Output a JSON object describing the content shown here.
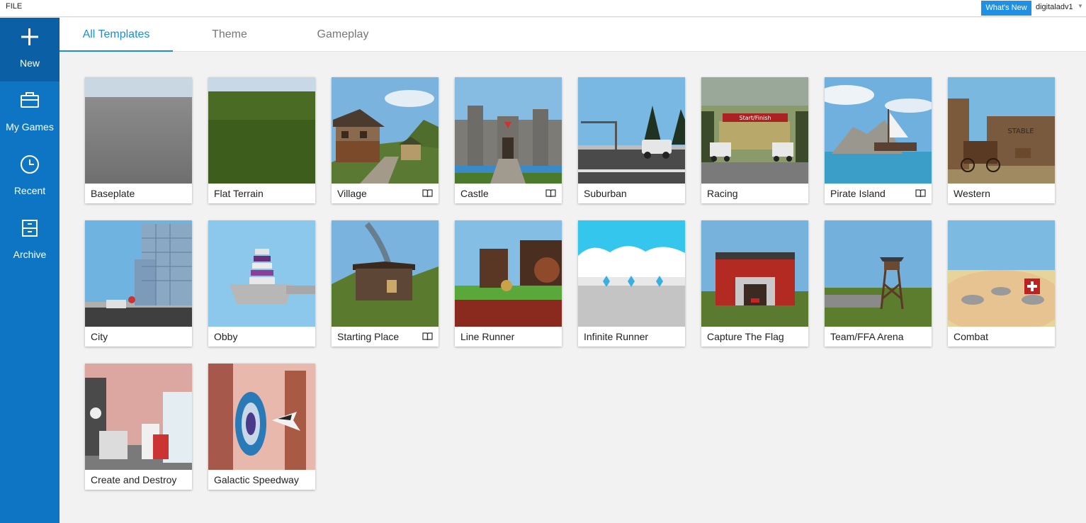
{
  "menu": {
    "file": "FILE"
  },
  "header": {
    "whats_new": "What's New",
    "username": "digitaladv1"
  },
  "sidebar": {
    "items": [
      {
        "label": "New",
        "icon": "plus-icon",
        "active": true
      },
      {
        "label": "My Games",
        "icon": "briefcase-icon",
        "active": false
      },
      {
        "label": "Recent",
        "icon": "clock-icon",
        "active": false
      },
      {
        "label": "Archive",
        "icon": "archive-icon",
        "active": false
      }
    ]
  },
  "tabs": [
    {
      "label": "All Templates",
      "active": true
    },
    {
      "label": "Theme",
      "active": false
    },
    {
      "label": "Gameplay",
      "active": false
    }
  ],
  "templates": [
    {
      "label": "Baseplate",
      "has_guide": false
    },
    {
      "label": "Flat Terrain",
      "has_guide": false
    },
    {
      "label": "Village",
      "has_guide": true
    },
    {
      "label": "Castle",
      "has_guide": true
    },
    {
      "label": "Suburban",
      "has_guide": false
    },
    {
      "label": "Racing",
      "has_guide": false,
      "banner": "Start/Finish"
    },
    {
      "label": "Pirate Island",
      "has_guide": true
    },
    {
      "label": "Western",
      "has_guide": false,
      "sign": "STABLE"
    },
    {
      "label": "City",
      "has_guide": false
    },
    {
      "label": "Obby",
      "has_guide": false
    },
    {
      "label": "Starting Place",
      "has_guide": true
    },
    {
      "label": "Line Runner",
      "has_guide": false
    },
    {
      "label": "Infinite Runner",
      "has_guide": false
    },
    {
      "label": "Capture The Flag",
      "has_guide": false
    },
    {
      "label": "Team/FFA Arena",
      "has_guide": false
    },
    {
      "label": "Combat",
      "has_guide": false
    },
    {
      "label": "Create and Destroy",
      "has_guide": false
    },
    {
      "label": "Galactic Speedway",
      "has_guide": false
    }
  ],
  "colors": {
    "accent": "#1a8fd8",
    "sidebar": "#0e75c4",
    "sidebar_active": "#0b5fa4",
    "whats_new": "#1e90e6"
  }
}
